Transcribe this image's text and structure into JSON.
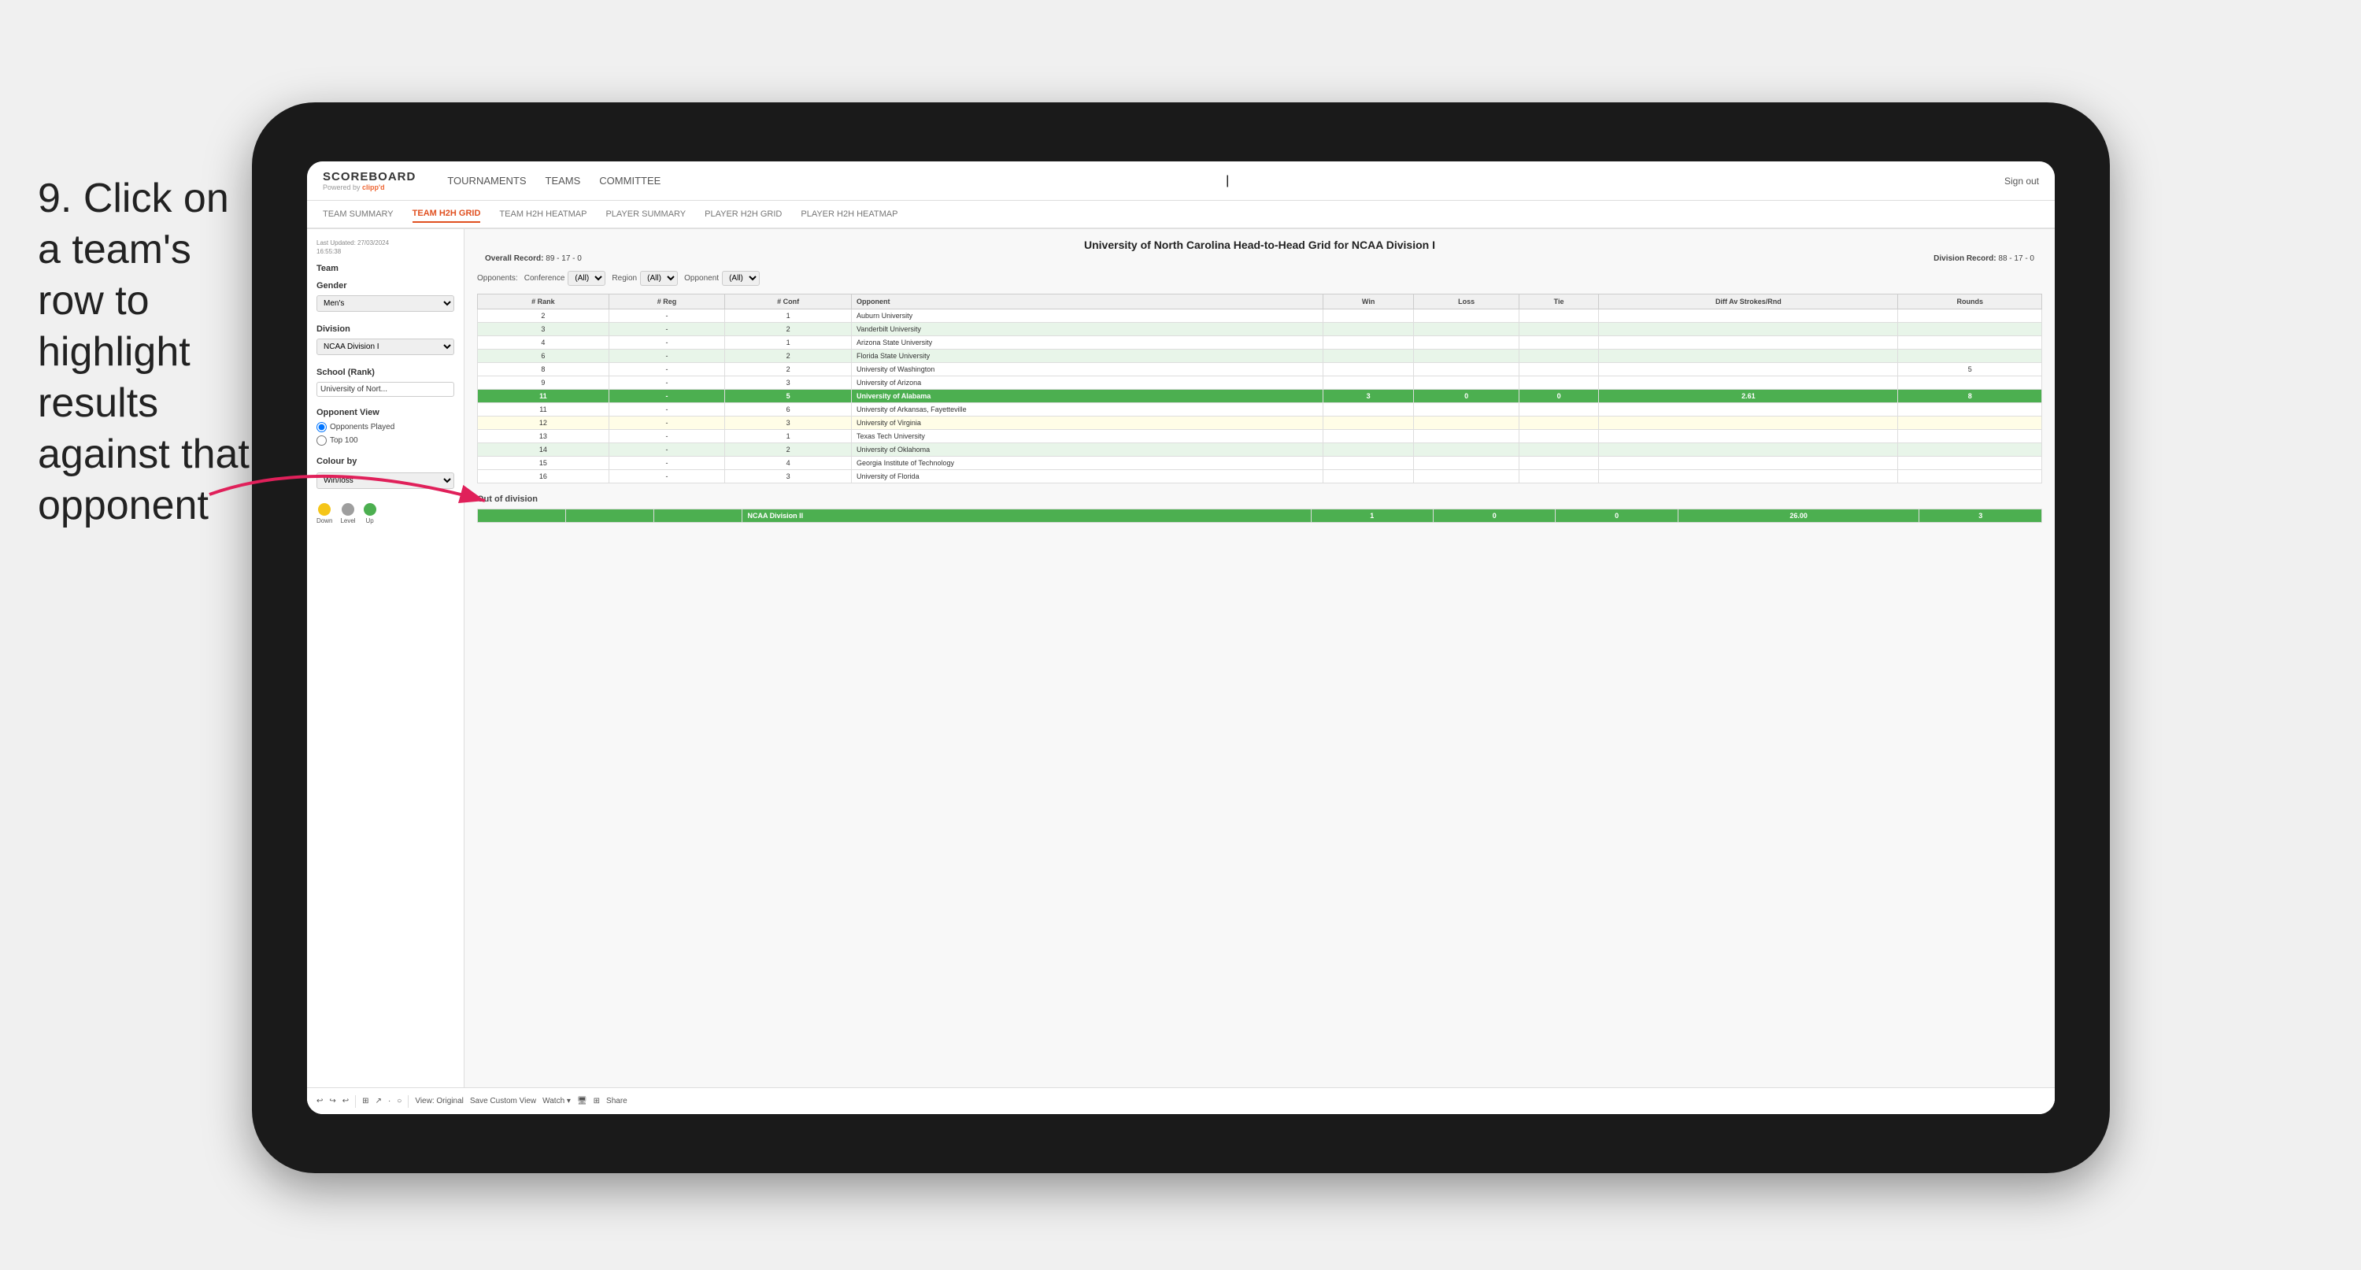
{
  "instruction": {
    "number": "9.",
    "text": "Click on a team's row to highlight results against that opponent"
  },
  "tablet": {
    "nav": {
      "logo": "SCOREBOARD",
      "logo_sub": "Powered by",
      "logo_brand": "clipp'd",
      "items": [
        "TOURNAMENTS",
        "TEAMS",
        "COMMITTEE"
      ],
      "sign_out": "Sign out"
    },
    "sub_nav": {
      "items": [
        "TEAM SUMMARY",
        "TEAM H2H GRID",
        "TEAM H2H HEATMAP",
        "PLAYER SUMMARY",
        "PLAYER H2H GRID",
        "PLAYER H2H HEATMAP"
      ],
      "active": "TEAM H2H GRID"
    },
    "left_panel": {
      "last_updated": "Last Updated: 27/03/2024\n16:55:38",
      "team_label": "Team",
      "gender_label": "Gender",
      "gender_value": "Men's",
      "division_label": "Division",
      "division_value": "NCAA Division I",
      "school_rank_label": "School (Rank)",
      "school_rank_value": "University of Nort...",
      "opponent_view_label": "Opponent View",
      "radio_options": [
        "Opponents Played",
        "Top 100"
      ],
      "radio_selected": "Opponents Played",
      "colour_by_label": "Colour by",
      "colour_by_value": "Win/loss",
      "legend": [
        {
          "label": "Down",
          "color": "#f5c518"
        },
        {
          "label": "Level",
          "color": "#9e9e9e"
        },
        {
          "label": "Up",
          "color": "#4caf50"
        }
      ]
    },
    "grid": {
      "title": "University of North Carolina Head-to-Head Grid for NCAA Division I",
      "overall_record_label": "Overall Record:",
      "overall_record": "89 - 17 - 0",
      "division_record_label": "Division Record:",
      "division_record": "88 - 17 - 0",
      "filter_label": "Opponents:",
      "conference_label": "Conference",
      "conference_value": "(All)",
      "region_label": "Region",
      "region_value": "(All)",
      "opponent_label": "Opponent",
      "opponent_value": "(All)",
      "table_headers": [
        "# Rank",
        "# Reg",
        "# Conf",
        "Opponent",
        "Win",
        "Loss",
        "Tie",
        "Diff Av Strokes/Rnd",
        "Rounds"
      ],
      "rows": [
        {
          "rank": "2",
          "reg": "-",
          "conf": "1",
          "opponent": "Auburn University",
          "win": "",
          "loss": "",
          "tie": "",
          "diff": "",
          "rounds": "",
          "style": "normal"
        },
        {
          "rank": "3",
          "reg": "-",
          "conf": "2",
          "opponent": "Vanderbilt University",
          "win": "",
          "loss": "",
          "tie": "",
          "diff": "",
          "rounds": "",
          "style": "light-green"
        },
        {
          "rank": "4",
          "reg": "-",
          "conf": "1",
          "opponent": "Arizona State University",
          "win": "",
          "loss": "",
          "tie": "",
          "diff": "",
          "rounds": "",
          "style": "normal"
        },
        {
          "rank": "6",
          "reg": "-",
          "conf": "2",
          "opponent": "Florida State University",
          "win": "",
          "loss": "",
          "tie": "",
          "diff": "",
          "rounds": "",
          "style": "light-green"
        },
        {
          "rank": "8",
          "reg": "-",
          "conf": "2",
          "opponent": "University of Washington",
          "win": "",
          "loss": "",
          "tie": "",
          "diff": "",
          "rounds": "5",
          "style": "normal"
        },
        {
          "rank": "9",
          "reg": "-",
          "conf": "3",
          "opponent": "University of Arizona",
          "win": "",
          "loss": "",
          "tie": "",
          "diff": "",
          "rounds": "",
          "style": "normal"
        },
        {
          "rank": "11",
          "reg": "-",
          "conf": "5",
          "opponent": "University of Alabama",
          "win": "3",
          "loss": "0",
          "tie": "0",
          "diff": "2.61",
          "rounds": "8",
          "style": "highlighted"
        },
        {
          "rank": "11",
          "reg": "-",
          "conf": "6",
          "opponent": "University of Arkansas, Fayetteville",
          "win": "",
          "loss": "",
          "tie": "",
          "diff": "",
          "rounds": "",
          "style": "normal"
        },
        {
          "rank": "12",
          "reg": "-",
          "conf": "3",
          "opponent": "University of Virginia",
          "win": "",
          "loss": "",
          "tie": "",
          "diff": "",
          "rounds": "",
          "style": "light-yellow"
        },
        {
          "rank": "13",
          "reg": "-",
          "conf": "1",
          "opponent": "Texas Tech University",
          "win": "",
          "loss": "",
          "tie": "",
          "diff": "",
          "rounds": "",
          "style": "normal"
        },
        {
          "rank": "14",
          "reg": "-",
          "conf": "2",
          "opponent": "University of Oklahoma",
          "win": "",
          "loss": "",
          "tie": "",
          "diff": "",
          "rounds": "",
          "style": "light-green"
        },
        {
          "rank": "15",
          "reg": "-",
          "conf": "4",
          "opponent": "Georgia Institute of Technology",
          "win": "",
          "loss": "",
          "tie": "",
          "diff": "",
          "rounds": "",
          "style": "normal"
        },
        {
          "rank": "16",
          "reg": "-",
          "conf": "3",
          "opponent": "University of Florida",
          "win": "",
          "loss": "",
          "tie": "",
          "diff": "",
          "rounds": "",
          "style": "normal"
        }
      ],
      "out_of_division_label": "Out of division",
      "out_of_division_row": {
        "label": "NCAA Division II",
        "win": "1",
        "loss": "0",
        "tie": "0",
        "diff": "26.00",
        "rounds": "3"
      }
    },
    "toolbar": {
      "items": [
        "↩",
        "↪",
        "↩",
        "⊞",
        "↗",
        "·",
        "○",
        "View: Original",
        "Save Custom View",
        "Watch ▾",
        "🖥",
        "⊞",
        "Share"
      ]
    }
  }
}
